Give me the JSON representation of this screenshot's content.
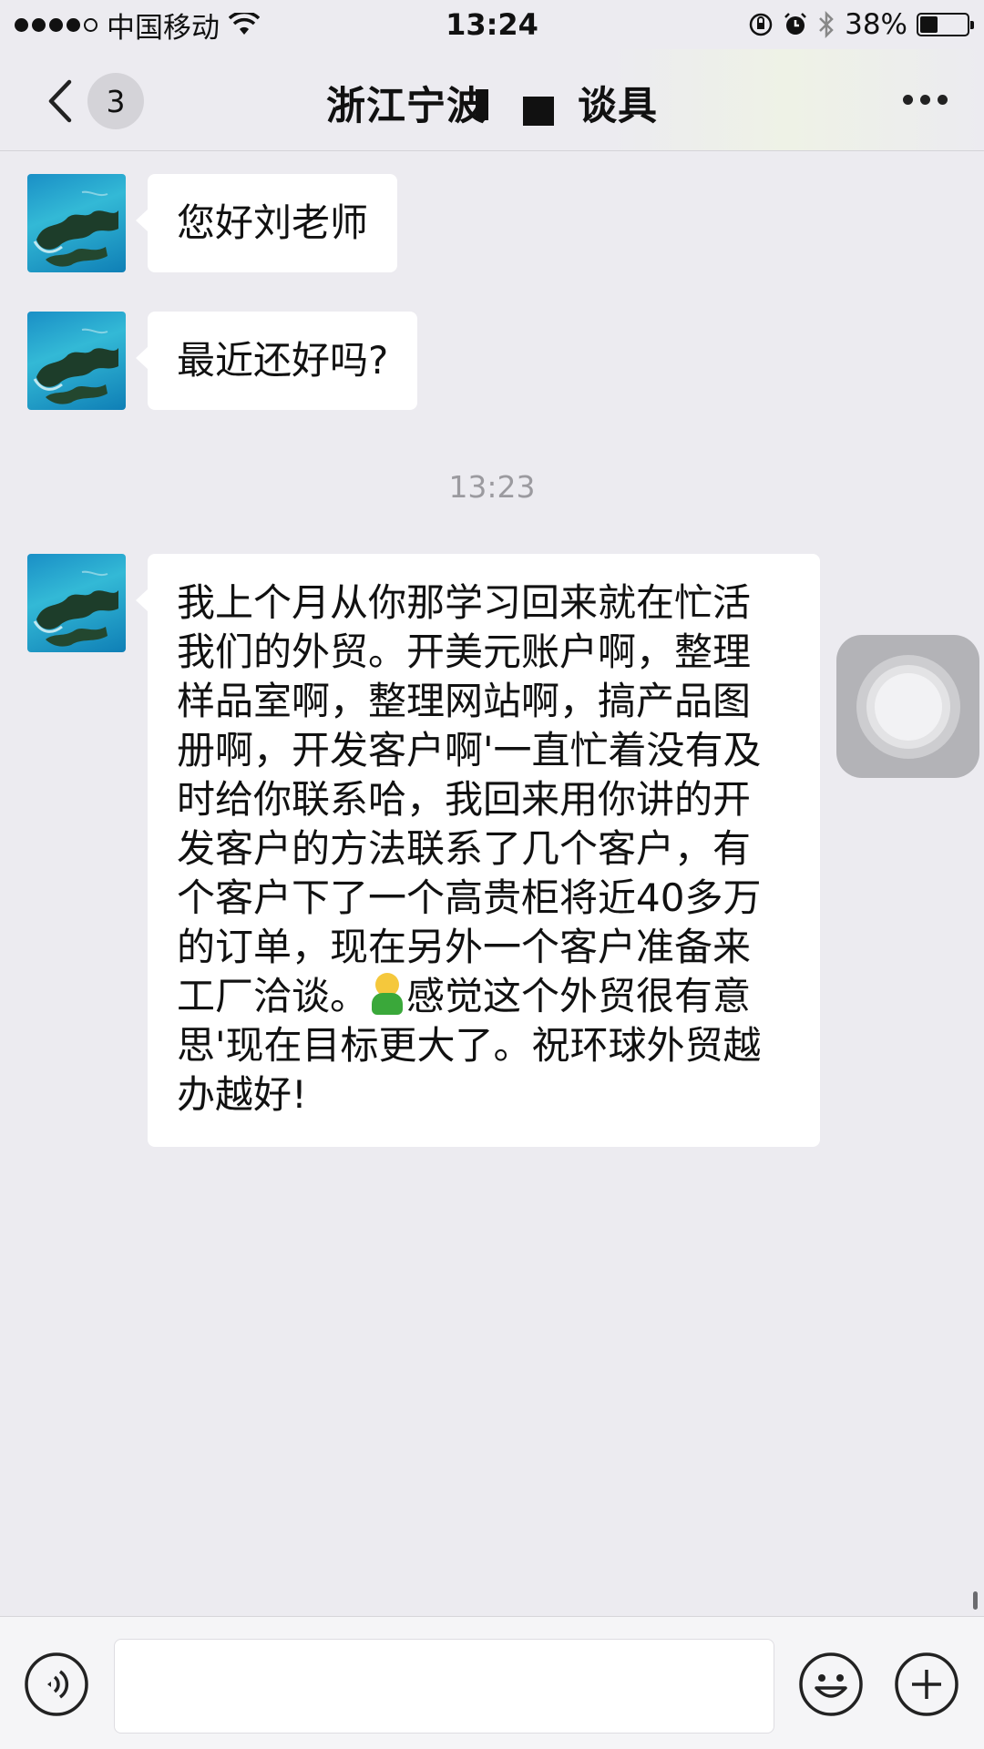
{
  "status_bar": {
    "carrier": "中国移动",
    "time": "13:24",
    "battery_percent": "38%",
    "battery_level": 0.38,
    "icons": [
      "signal-dots",
      "wifi-icon",
      "rotation-lock-icon",
      "alarm-icon",
      "bluetooth-icon",
      "battery-icon"
    ]
  },
  "nav": {
    "back_icon": "chevron-left-icon",
    "unread_count": "3",
    "title_start": "浙江宁波",
    "title_end": "谈具",
    "more_icon": "more-dots-icon"
  },
  "messages": [
    {
      "text": "您好刘老师"
    },
    {
      "text": "最近还好吗?"
    }
  ],
  "timestamp": "13:23",
  "long_message": {
    "lines": [
      "我上个月从你那学习回来就在忙活",
      "我们的外贸。开美元账户啊，整理",
      "样品室啊，整理网站啊，搞产品图",
      "册啊，开发客户啊'一直忙着没有及",
      "时给你联系哈，我回来用你讲的开",
      "发客户的方法联系了几个客户，有",
      "个客户下了一个高贵柜将近40多万",
      "的订单，现在另外一个客户准备来"
    ],
    "line9_before_emoji": "工厂洽谈。",
    "emoji": "person-emoji",
    "line9_after_emoji": "感觉这个外贸很有意",
    "line10": "思'现在目标更大了。祝环球外贸越",
    "line11": "办越好!"
  },
  "input_bar": {
    "voice_icon": "voice-icon",
    "input_value": "",
    "emoji_icon": "smiley-icon",
    "plus_icon": "plus-icon"
  },
  "colors": {
    "background": "#ecebf0",
    "bubble": "#ffffff",
    "timestamp": "#9b9a9f"
  }
}
